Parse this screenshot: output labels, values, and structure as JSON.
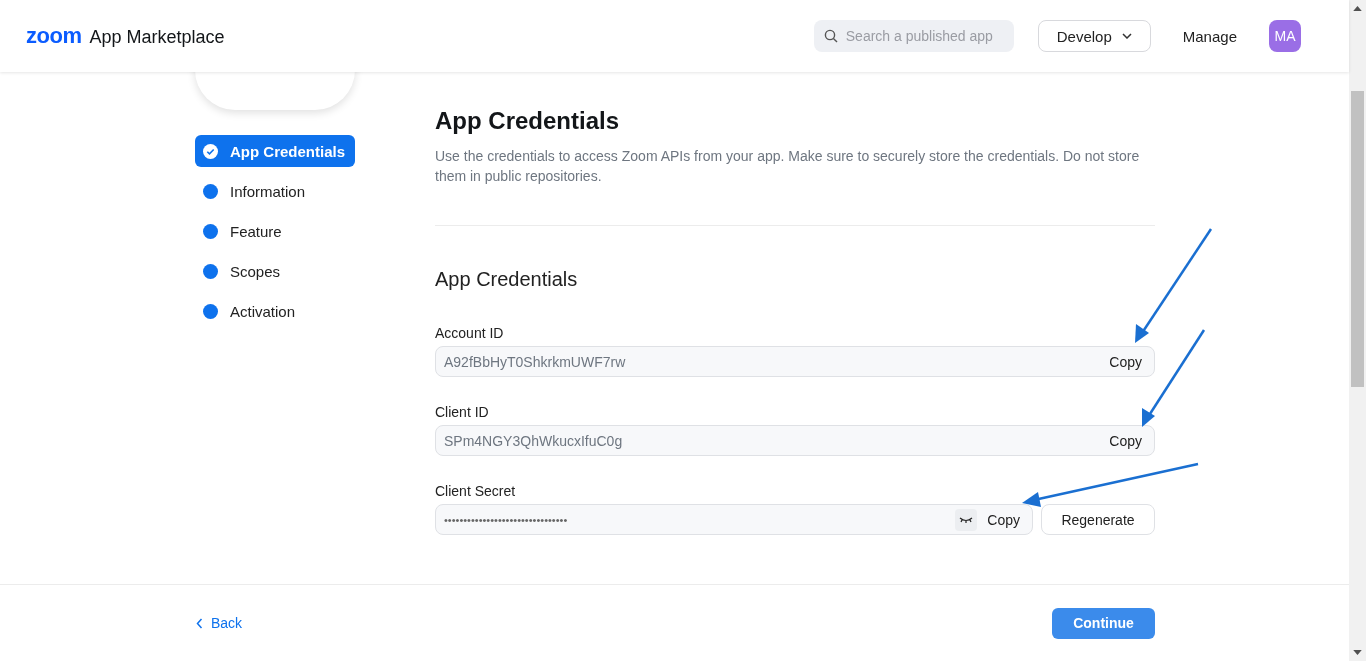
{
  "header": {
    "logo": "zoom",
    "title": "App Marketplace",
    "search": {
      "placeholder": "Search a published app"
    },
    "develop": "Develop",
    "manage": "Manage",
    "avatar": "MA"
  },
  "steps": [
    {
      "label": "App Credentials",
      "selected": true
    },
    {
      "label": "Information",
      "selected": false
    },
    {
      "label": "Feature",
      "selected": false
    },
    {
      "label": "Scopes",
      "selected": false
    },
    {
      "label": "Activation",
      "selected": false
    }
  ],
  "page": {
    "title": "App Credentials",
    "description": "Use the credentials to access Zoom APIs from your app. Make sure to securely store the credentials. Do not store them in public repositories.",
    "section": "App Credentials"
  },
  "fields": [
    {
      "kind": "text",
      "label": "Account ID",
      "value": "A92fBbHyT0ShkrkmUWF7rw",
      "copy": "Copy"
    },
    {
      "kind": "text",
      "label": "Client ID",
      "value": "SPm4NGY3QhWkucxIfuC0g",
      "copy": "Copy"
    },
    {
      "kind": "secret",
      "label": "Client Secret",
      "value": "••••••••••••••••••••••••••••••••",
      "copy": "Copy",
      "regenerate": "Regenerate"
    }
  ],
  "footer": {
    "back": "Back",
    "continue": "Continue"
  }
}
